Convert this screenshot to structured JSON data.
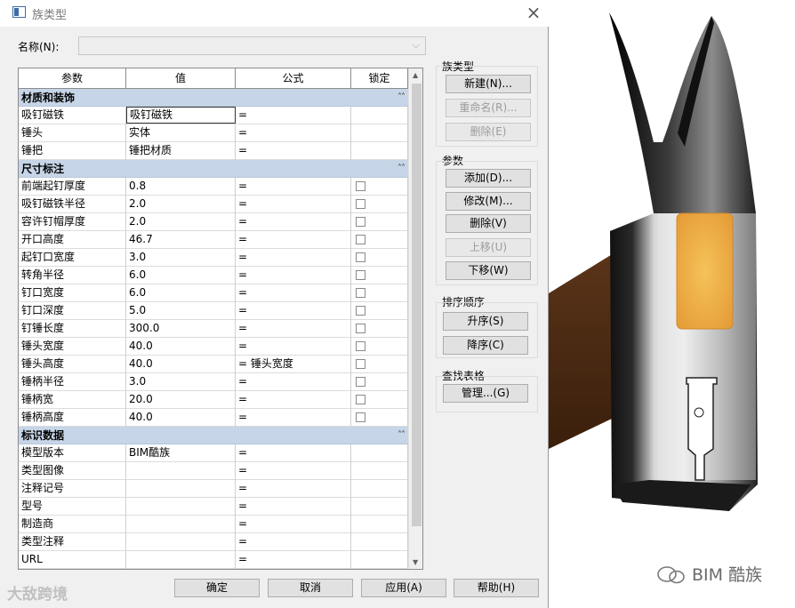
{
  "dialog": {
    "title": "族类型",
    "close_glyph": "×",
    "name_label": "名称(N):",
    "name_value": ""
  },
  "grid": {
    "headers": [
      "参数",
      "值",
      "公式",
      "锁定"
    ],
    "groups": [
      {
        "title": "材质和装饰",
        "collapse_glyph": "˄˄",
        "rows": [
          {
            "param": "吸钉磁铁",
            "value": "吸钉磁铁",
            "formula": "=",
            "lock": false
          },
          {
            "param": "锤头",
            "value": "实体",
            "formula": "=",
            "lock": false
          },
          {
            "param": "锤把",
            "value": "锤把材质",
            "formula": "=",
            "lock": false
          }
        ]
      },
      {
        "title": "尺寸标注",
        "collapse_glyph": "˄˄",
        "rows": [
          {
            "param": "前端起钉厚度",
            "value": "0.8",
            "formula": "=",
            "lock": true
          },
          {
            "param": "吸钉磁铁半径",
            "value": "2.0",
            "formula": "=",
            "lock": true
          },
          {
            "param": "容许钉帽厚度",
            "value": "2.0",
            "formula": "=",
            "lock": true
          },
          {
            "param": "开口高度",
            "value": "46.7",
            "formula": "=",
            "lock": true
          },
          {
            "param": "起钉口宽度",
            "value": "3.0",
            "formula": "=",
            "lock": true
          },
          {
            "param": "转角半径",
            "value": "6.0",
            "formula": "=",
            "lock": true
          },
          {
            "param": "钉口宽度",
            "value": "6.0",
            "formula": "=",
            "lock": true
          },
          {
            "param": "钉口深度",
            "value": "5.0",
            "formula": "=",
            "lock": true
          },
          {
            "param": "钉锤长度",
            "value": "300.0",
            "formula": "=",
            "lock": true
          },
          {
            "param": "锤头宽度",
            "value": "40.0",
            "formula": "=",
            "lock": true
          },
          {
            "param": "锤头高度",
            "value": "40.0",
            "formula": "= 锤头宽度",
            "lock": true
          },
          {
            "param": "锤柄半径",
            "value": "3.0",
            "formula": "=",
            "lock": true
          },
          {
            "param": "锤柄宽",
            "value": "20.0",
            "formula": "=",
            "lock": true
          },
          {
            "param": "锤柄高度",
            "value": "40.0",
            "formula": "=",
            "lock": true
          }
        ]
      },
      {
        "title": "标识数据",
        "collapse_glyph": "˄˄",
        "rows": [
          {
            "param": "模型版本",
            "value": "BIM酷族",
            "formula": "=",
            "lock": false
          },
          {
            "param": "类型图像",
            "value": "",
            "formula": "=",
            "lock": false
          },
          {
            "param": "注释记号",
            "value": "",
            "formula": "=",
            "lock": false
          },
          {
            "param": "型号",
            "value": "",
            "formula": "=",
            "lock": false
          },
          {
            "param": "制造商",
            "value": "",
            "formula": "=",
            "lock": false
          },
          {
            "param": "类型注释",
            "value": "",
            "formula": "=",
            "lock": false
          },
          {
            "param": "URL",
            "value": "",
            "formula": "=",
            "lock": false
          }
        ]
      }
    ]
  },
  "family_types": {
    "title": "族类型",
    "new": "新建(N)...",
    "rename": "重命名(R)...",
    "delete": "删除(E)"
  },
  "parameters": {
    "title": "参数",
    "add": "添加(D)...",
    "modify": "修改(M)...",
    "delete": "删除(V)",
    "move_up": "上移(U)",
    "move_down": "下移(W)"
  },
  "sort": {
    "title": "排序顺序",
    "ascending": "升序(S)",
    "descending": "降序(C)"
  },
  "lookup": {
    "title": "查找表格",
    "manage": "管理...(G)"
  },
  "footer": {
    "ok": "确定",
    "cancel": "取消",
    "apply": "应用(A)",
    "help": "帮助(H)"
  },
  "watermarks": {
    "left": "大敌跨境",
    "right": "BIM 酷族"
  },
  "colors": {
    "group_header": "#c6d5e7",
    "dialog_bg": "#f0f0f0",
    "insert_orange": "#f0ad46",
    "handle_brown": "#4a2a14"
  }
}
